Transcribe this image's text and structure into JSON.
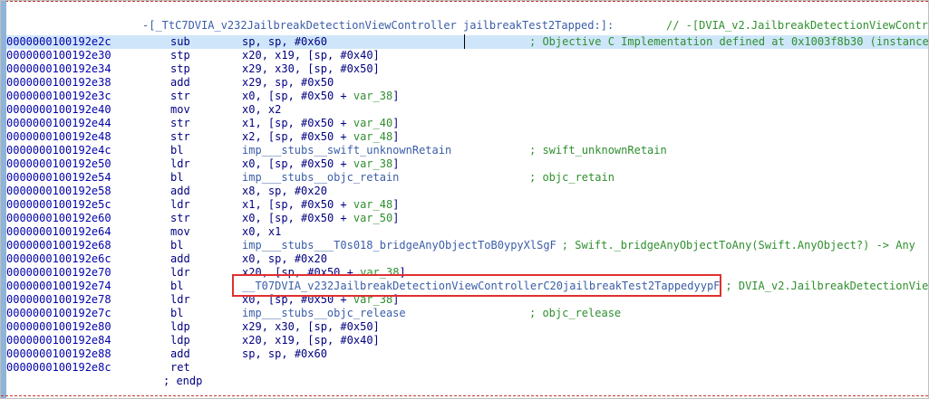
{
  "procedure": {
    "header": "-[_TtC7DVIA_v232JailbreakDetectionViewController jailbreakTest2Tapped:]:",
    "header_comment": "// -[DVIA_v2.JailbreakDetectionViewContro",
    "endp": "; endp"
  },
  "lines": [
    {
      "addr": "0000000100192e2c",
      "mnem": "sub",
      "ops": [
        [
          "reg",
          "sp"
        ],
        [
          "p",
          ", "
        ],
        [
          "reg",
          "sp"
        ],
        [
          "p",
          ", "
        ],
        [
          "num",
          "#0x60"
        ]
      ],
      "comment": "; Objective C Implementation defined at 0x1003f8b30 (instance",
      "selected": true
    },
    {
      "addr": "0000000100192e30",
      "mnem": "stp",
      "ops": [
        [
          "reg",
          "x20"
        ],
        [
          "p",
          ", "
        ],
        [
          "reg",
          "x19"
        ],
        [
          "p",
          ", ["
        ],
        [
          "reg",
          "sp"
        ],
        [
          "p",
          ", "
        ],
        [
          "num",
          "#0x40"
        ],
        [
          "p",
          "]"
        ]
      ]
    },
    {
      "addr": "0000000100192e34",
      "mnem": "stp",
      "ops": [
        [
          "reg",
          "x29"
        ],
        [
          "p",
          ", "
        ],
        [
          "reg",
          "x30"
        ],
        [
          "p",
          ", ["
        ],
        [
          "reg",
          "sp"
        ],
        [
          "p",
          ", "
        ],
        [
          "num",
          "#0x50"
        ],
        [
          "p",
          "]"
        ]
      ]
    },
    {
      "addr": "0000000100192e38",
      "mnem": "add",
      "ops": [
        [
          "reg",
          "x29"
        ],
        [
          "p",
          ", "
        ],
        [
          "reg",
          "sp"
        ],
        [
          "p",
          ", "
        ],
        [
          "num",
          "#0x50"
        ]
      ]
    },
    {
      "addr": "0000000100192e3c",
      "mnem": "str",
      "ops": [
        [
          "reg",
          "x0"
        ],
        [
          "p",
          ", ["
        ],
        [
          "reg",
          "sp"
        ],
        [
          "p",
          ", "
        ],
        [
          "num",
          "#0x50"
        ],
        [
          "p",
          " + "
        ],
        [
          "var",
          "var_38"
        ],
        [
          "p",
          "]"
        ]
      ]
    },
    {
      "addr": "0000000100192e40",
      "mnem": "mov",
      "ops": [
        [
          "reg",
          "x0"
        ],
        [
          "p",
          ", "
        ],
        [
          "reg",
          "x2"
        ]
      ]
    },
    {
      "addr": "0000000100192e44",
      "mnem": "str",
      "ops": [
        [
          "reg",
          "x1"
        ],
        [
          "p",
          ", ["
        ],
        [
          "reg",
          "sp"
        ],
        [
          "p",
          ", "
        ],
        [
          "num",
          "#0x50"
        ],
        [
          "p",
          " + "
        ],
        [
          "var",
          "var_40"
        ],
        [
          "p",
          "]"
        ]
      ]
    },
    {
      "addr": "0000000100192e48",
      "mnem": "str",
      "ops": [
        [
          "reg",
          "x2"
        ],
        [
          "p",
          ", ["
        ],
        [
          "reg",
          "sp"
        ],
        [
          "p",
          ", "
        ],
        [
          "num",
          "#0x50"
        ],
        [
          "p",
          " + "
        ],
        [
          "var",
          "var_48"
        ],
        [
          "p",
          "]"
        ]
      ]
    },
    {
      "addr": "0000000100192e4c",
      "mnem": "bl",
      "ops": [
        [
          "sym",
          "imp___stubs__swift_unknownRetain"
        ]
      ],
      "comment": "; swift_unknownRetain"
    },
    {
      "addr": "0000000100192e50",
      "mnem": "ldr",
      "ops": [
        [
          "reg",
          "x0"
        ],
        [
          "p",
          ", ["
        ],
        [
          "reg",
          "sp"
        ],
        [
          "p",
          ", "
        ],
        [
          "num",
          "#0x50"
        ],
        [
          "p",
          " + "
        ],
        [
          "var",
          "var_38"
        ],
        [
          "p",
          "]"
        ]
      ]
    },
    {
      "addr": "0000000100192e54",
      "mnem": "bl",
      "ops": [
        [
          "sym",
          "imp___stubs__objc_retain"
        ]
      ],
      "comment": "; objc_retain"
    },
    {
      "addr": "0000000100192e58",
      "mnem": "add",
      "ops": [
        [
          "reg",
          "x8"
        ],
        [
          "p",
          ", "
        ],
        [
          "reg",
          "sp"
        ],
        [
          "p",
          ", "
        ],
        [
          "num",
          "#0x20"
        ]
      ]
    },
    {
      "addr": "0000000100192e5c",
      "mnem": "ldr",
      "ops": [
        [
          "reg",
          "x1"
        ],
        [
          "p",
          ", ["
        ],
        [
          "reg",
          "sp"
        ],
        [
          "p",
          ", "
        ],
        [
          "num",
          "#0x50"
        ],
        [
          "p",
          " + "
        ],
        [
          "var",
          "var_48"
        ],
        [
          "p",
          "]"
        ]
      ]
    },
    {
      "addr": "0000000100192e60",
      "mnem": "str",
      "ops": [
        [
          "reg",
          "x0"
        ],
        [
          "p",
          ", ["
        ],
        [
          "reg",
          "sp"
        ],
        [
          "p",
          ", "
        ],
        [
          "num",
          "#0x50"
        ],
        [
          "p",
          " + "
        ],
        [
          "var",
          "var_50"
        ],
        [
          "p",
          "]"
        ]
      ]
    },
    {
      "addr": "0000000100192e64",
      "mnem": "mov",
      "ops": [
        [
          "reg",
          "x0"
        ],
        [
          "p",
          ", "
        ],
        [
          "reg",
          "x1"
        ]
      ]
    },
    {
      "addr": "0000000100192e68",
      "mnem": "bl",
      "ops": [
        [
          "sym",
          "imp___stubs___T0s018_bridgeAnyObjectToB0ypyXlSgF"
        ]
      ],
      "comment_extra": "; Swift._bridgeAnyObjectToAny(Swift.AnyObject?) -> Any"
    },
    {
      "addr": "0000000100192e6c",
      "mnem": "add",
      "ops": [
        [
          "reg",
          "x0"
        ],
        [
          "p",
          ", "
        ],
        [
          "reg",
          "sp"
        ],
        [
          "p",
          ", "
        ],
        [
          "num",
          "#0x20"
        ]
      ]
    },
    {
      "addr": "0000000100192e70",
      "mnem": "ldr",
      "ops": [
        [
          "reg",
          "x20"
        ],
        [
          "p",
          ", ["
        ],
        [
          "reg",
          "sp"
        ],
        [
          "p",
          ", "
        ],
        [
          "num",
          "#0x50"
        ],
        [
          "p",
          " + "
        ],
        [
          "var",
          "var_38"
        ],
        [
          "p",
          "]"
        ]
      ]
    },
    {
      "addr": "0000000100192e74",
      "mnem": "bl",
      "ops": [
        [
          "sym",
          "__T07DVIA_v232JailbreakDetectionViewControllerC20jailbreakTest2TappedyypF"
        ]
      ],
      "comment_extra": "; DVIA_v2.JailbreakDetectionVie"
    },
    {
      "addr": "0000000100192e78",
      "mnem": "ldr",
      "ops": [
        [
          "reg",
          "x0"
        ],
        [
          "p",
          ", ["
        ],
        [
          "reg",
          "sp"
        ],
        [
          "p",
          ", "
        ],
        [
          "num",
          "#0x50"
        ],
        [
          "p",
          " + "
        ],
        [
          "var",
          "var_38"
        ],
        [
          "p",
          "]"
        ]
      ]
    },
    {
      "addr": "0000000100192e7c",
      "mnem": "bl",
      "ops": [
        [
          "sym",
          "imp___stubs__objc_release"
        ]
      ],
      "comment": "; objc_release"
    },
    {
      "addr": "0000000100192e80",
      "mnem": "ldp",
      "ops": [
        [
          "reg",
          "x29"
        ],
        [
          "p",
          ", "
        ],
        [
          "reg",
          "x30"
        ],
        [
          "p",
          ", ["
        ],
        [
          "reg",
          "sp"
        ],
        [
          "p",
          ", "
        ],
        [
          "num",
          "#0x50"
        ],
        [
          "p",
          "]"
        ]
      ]
    },
    {
      "addr": "0000000100192e84",
      "mnem": "ldp",
      "ops": [
        [
          "reg",
          "x20"
        ],
        [
          "p",
          ", "
        ],
        [
          "reg",
          "x19"
        ],
        [
          "p",
          ", ["
        ],
        [
          "reg",
          "sp"
        ],
        [
          "p",
          ", "
        ],
        [
          "num",
          "#0x40"
        ],
        [
          "p",
          "]"
        ]
      ]
    },
    {
      "addr": "0000000100192e88",
      "mnem": "add",
      "ops": [
        [
          "reg",
          "sp"
        ],
        [
          "p",
          ", "
        ],
        [
          "reg",
          "sp"
        ],
        [
          "p",
          ", "
        ],
        [
          "num",
          "#0x60"
        ]
      ]
    },
    {
      "addr": "0000000100192e8c",
      "mnem": "ret",
      "ops": []
    }
  ],
  "highlight": {
    "label": "highlighted-call-target",
    "color": "#e03030"
  },
  "colors": {
    "address": "#0000aa",
    "comment": "#2f8f2f",
    "symbol": "#3a5ea8",
    "selection": "#cfe6fa",
    "gutter": "#8fb4d9"
  }
}
